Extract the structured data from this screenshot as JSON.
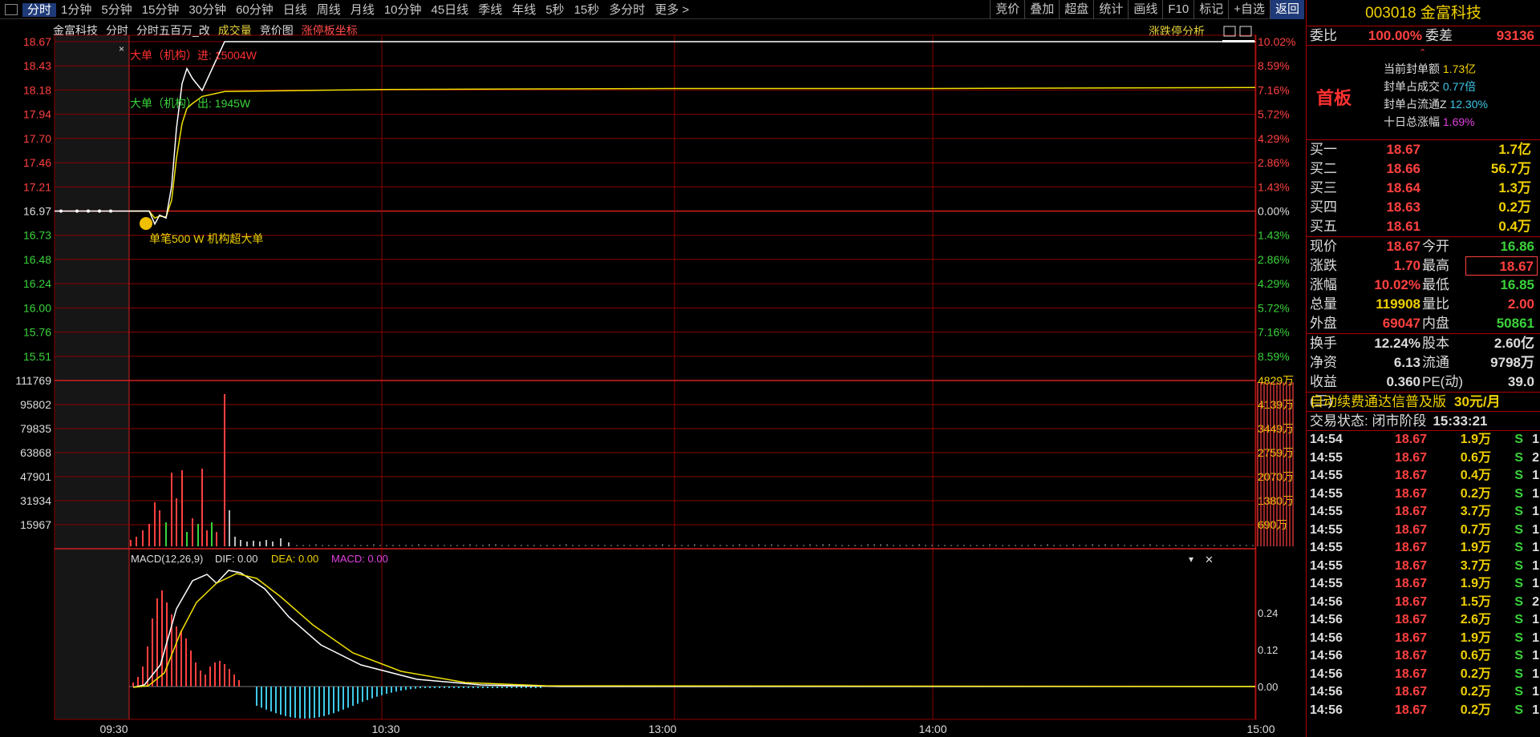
{
  "toolbar": {
    "tabs": [
      "分时",
      "1分钟",
      "5分钟",
      "15分钟",
      "30分钟",
      "60分钟",
      "日线",
      "周线",
      "月线",
      "10分钟",
      "45日线",
      "季线",
      "年线",
      "5秒",
      "15秒",
      "多分时",
      "更多 >"
    ],
    "active_tab": "分时",
    "right_tools": [
      "竞价",
      "叠加",
      "超盘",
      "统计",
      "画线",
      "F10",
      "标记",
      "+自选",
      "返回"
    ]
  },
  "chart_header": {
    "stock_name": "金富科技",
    "mode": "分时",
    "indicator": "分时五百万_改",
    "volume_label": "成交量",
    "auction_label": "竞价图",
    "limit_coord_label": "涨停板坐标",
    "limit_analysis": "涨跌停分析"
  },
  "annotations": {
    "big_buy": "大单（机构）进: 15004W",
    "big_sell": "大单（机构）出: 1945W",
    "super_order": "单笔500 W 机构超大单"
  },
  "price_axis": {
    "left": [
      "18.67",
      "18.43",
      "18.18",
      "17.94",
      "17.70",
      "17.46",
      "17.21",
      "16.97",
      "16.73",
      "16.48",
      "16.24",
      "16.00",
      "15.76",
      "15.51"
    ],
    "right": [
      "10.02%",
      "8.59%",
      "7.16%",
      "5.72%",
      "4.29%",
      "2.86%",
      "1.43%",
      "0.00%",
      "1.43%",
      "2.86%",
      "4.29%",
      "5.72%",
      "7.16%",
      "8.59%"
    ]
  },
  "volume_axis": {
    "left": [
      "111769",
      "95802",
      "79835",
      "63868",
      "47901",
      "31934",
      "15967"
    ],
    "right": [
      "4829万",
      "4139万",
      "3449万",
      "2759万",
      "2070万",
      "1380万",
      "690万"
    ]
  },
  "macd": {
    "title": "MACD(12,26,9)",
    "dif": "DIF: 0.00",
    "dea": "DEA: 0.00",
    "macd": "MACD: 0.00",
    "axis": [
      "0.24",
      "0.12",
      "0.00"
    ]
  },
  "time_axis": [
    "09:30",
    "10:30",
    "13:00",
    "14:00",
    "15:00"
  ],
  "colors": {
    "up": "#ff4040",
    "down": "#3ad33a",
    "price_line": "#ffffff",
    "avg_line": "#f0e000",
    "grid": "#8b0000"
  },
  "chart_data": {
    "type": "line",
    "xlabel": "",
    "ylabel": "",
    "x": [
      "09:30",
      "09:32",
      "09:35",
      "09:38",
      "09:40",
      "09:42",
      "09:44",
      "09:46",
      "09:48",
      "09:50",
      "09:52",
      "09:54",
      "09:56",
      "09:58",
      "10:00",
      "10:30",
      "11:30",
      "13:00",
      "14:00",
      "15:00"
    ],
    "series": [
      {
        "values": [
          16.97,
          16.97,
          16.97,
          16.97,
          16.97,
          16.84,
          16.93,
          16.9,
          17.22,
          17.8,
          18.25,
          18.4,
          18.3,
          18.18,
          18.67,
          18.67,
          18.67,
          18.67,
          18.67,
          18.67
        ]
      },
      {
        "values": [
          16.97,
          16.97,
          16.97,
          16.97,
          16.97,
          16.9,
          16.92,
          16.91,
          17.08,
          17.5,
          17.85,
          18.0,
          18.05,
          18.12,
          18.17,
          18.19,
          18.2,
          18.2,
          18.2,
          18.21
        ]
      }
    ],
    "ylim": [
      15.27,
      18.67
    ]
  },
  "quote": {
    "title": "003018 金富科技",
    "wei_bi_label": "委比",
    "wei_bi": "100.00%",
    "wei_cha_label": "委差",
    "wei_cha": "93136",
    "board": "首板",
    "seal_amount_label": "当前封单额",
    "seal_amount": "1.73亿",
    "seal_ratio_label": "封单占成交",
    "seal_ratio": "0.77倍",
    "seal_float_label": "封单占流通Z",
    "seal_float": "12.30%",
    "ten_day_label": "十日总涨幅",
    "ten_day": "1.69%",
    "bids": [
      {
        "label": "买一",
        "price": "18.67",
        "vol": "1.7亿"
      },
      {
        "label": "买二",
        "price": "18.66",
        "vol": "56.7万"
      },
      {
        "label": "买三",
        "price": "18.64",
        "vol": "1.3万"
      },
      {
        "label": "买四",
        "price": "18.63",
        "vol": "0.2万"
      },
      {
        "label": "买五",
        "price": "18.61",
        "vol": "0.4万"
      }
    ],
    "stats": [
      {
        "l": "现价",
        "v": "18.67",
        "l2": "今开",
        "v2": "16.86"
      },
      {
        "l": "涨跌",
        "v": "1.70",
        "l2": "最高",
        "v2": "18.67"
      },
      {
        "l": "涨幅",
        "v": "10.02%",
        "l2": "最低",
        "v2": "16.85"
      },
      {
        "l": "总量",
        "v": "119908",
        "l2": "量比",
        "v2": "2.00"
      },
      {
        "l": "外盘",
        "v": "69047",
        "l2": "内盘",
        "v2": "50861"
      }
    ],
    "fund": [
      {
        "l": "换手",
        "v": "12.24%",
        "l2": "股本",
        "v2": "2.60亿"
      },
      {
        "l": "净资",
        "v": "6.13",
        "l2": "流通",
        "v2": "9798万"
      },
      {
        "l": "收益(三)",
        "v": "0.360",
        "l2": "PE(动)",
        "v2": "39.0"
      }
    ],
    "promo": "自动续费通达信普及版",
    "promo_price": "30元/月",
    "status_label": "交易状态: 闭市阶段",
    "status_time": "15:33:21",
    "ticks": [
      {
        "t": "14:54",
        "p": "18.67",
        "v": "1.9万",
        "s": "S",
        "n": "1"
      },
      {
        "t": "14:55",
        "p": "18.67",
        "v": "0.6万",
        "s": "S",
        "n": "2"
      },
      {
        "t": "14:55",
        "p": "18.67",
        "v": "0.4万",
        "s": "S",
        "n": "1"
      },
      {
        "t": "14:55",
        "p": "18.67",
        "v": "0.2万",
        "s": "S",
        "n": "1"
      },
      {
        "t": "14:55",
        "p": "18.67",
        "v": "3.7万",
        "s": "S",
        "n": "1"
      },
      {
        "t": "14:55",
        "p": "18.67",
        "v": "0.7万",
        "s": "S",
        "n": "1"
      },
      {
        "t": "14:55",
        "p": "18.67",
        "v": "1.9万",
        "s": "S",
        "n": "1"
      },
      {
        "t": "14:55",
        "p": "18.67",
        "v": "3.7万",
        "s": "S",
        "n": "1"
      },
      {
        "t": "14:55",
        "p": "18.67",
        "v": "1.9万",
        "s": "S",
        "n": "1"
      },
      {
        "t": "14:56",
        "p": "18.67",
        "v": "1.5万",
        "s": "S",
        "n": "2"
      },
      {
        "t": "14:56",
        "p": "18.67",
        "v": "2.6万",
        "s": "S",
        "n": "1"
      },
      {
        "t": "14:56",
        "p": "18.67",
        "v": "1.9万",
        "s": "S",
        "n": "1"
      },
      {
        "t": "14:56",
        "p": "18.67",
        "v": "0.6万",
        "s": "S",
        "n": "1"
      },
      {
        "t": "14:56",
        "p": "18.67",
        "v": "0.2万",
        "s": "S",
        "n": "1"
      },
      {
        "t": "14:56",
        "p": "18.67",
        "v": "0.2万",
        "s": "S",
        "n": "1"
      },
      {
        "t": "14:56",
        "p": "18.67",
        "v": "0.2万",
        "s": "S",
        "n": "1"
      }
    ]
  }
}
